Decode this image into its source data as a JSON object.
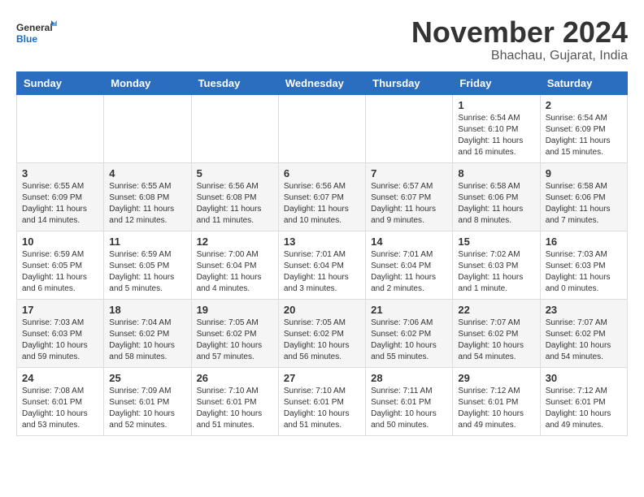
{
  "logo": {
    "general": "General",
    "blue": "Blue"
  },
  "title": "November 2024",
  "subtitle": "Bhachau, Gujarat, India",
  "days_of_week": [
    "Sunday",
    "Monday",
    "Tuesday",
    "Wednesday",
    "Thursday",
    "Friday",
    "Saturday"
  ],
  "weeks": [
    [
      {
        "day": "",
        "info": ""
      },
      {
        "day": "",
        "info": ""
      },
      {
        "day": "",
        "info": ""
      },
      {
        "day": "",
        "info": ""
      },
      {
        "day": "",
        "info": ""
      },
      {
        "day": "1",
        "info": "Sunrise: 6:54 AM\nSunset: 6:10 PM\nDaylight: 11 hours and 16 minutes."
      },
      {
        "day": "2",
        "info": "Sunrise: 6:54 AM\nSunset: 6:09 PM\nDaylight: 11 hours and 15 minutes."
      }
    ],
    [
      {
        "day": "3",
        "info": "Sunrise: 6:55 AM\nSunset: 6:09 PM\nDaylight: 11 hours and 14 minutes."
      },
      {
        "day": "4",
        "info": "Sunrise: 6:55 AM\nSunset: 6:08 PM\nDaylight: 11 hours and 12 minutes."
      },
      {
        "day": "5",
        "info": "Sunrise: 6:56 AM\nSunset: 6:08 PM\nDaylight: 11 hours and 11 minutes."
      },
      {
        "day": "6",
        "info": "Sunrise: 6:56 AM\nSunset: 6:07 PM\nDaylight: 11 hours and 10 minutes."
      },
      {
        "day": "7",
        "info": "Sunrise: 6:57 AM\nSunset: 6:07 PM\nDaylight: 11 hours and 9 minutes."
      },
      {
        "day": "8",
        "info": "Sunrise: 6:58 AM\nSunset: 6:06 PM\nDaylight: 11 hours and 8 minutes."
      },
      {
        "day": "9",
        "info": "Sunrise: 6:58 AM\nSunset: 6:06 PM\nDaylight: 11 hours and 7 minutes."
      }
    ],
    [
      {
        "day": "10",
        "info": "Sunrise: 6:59 AM\nSunset: 6:05 PM\nDaylight: 11 hours and 6 minutes."
      },
      {
        "day": "11",
        "info": "Sunrise: 6:59 AM\nSunset: 6:05 PM\nDaylight: 11 hours and 5 minutes."
      },
      {
        "day": "12",
        "info": "Sunrise: 7:00 AM\nSunset: 6:04 PM\nDaylight: 11 hours and 4 minutes."
      },
      {
        "day": "13",
        "info": "Sunrise: 7:01 AM\nSunset: 6:04 PM\nDaylight: 11 hours and 3 minutes."
      },
      {
        "day": "14",
        "info": "Sunrise: 7:01 AM\nSunset: 6:04 PM\nDaylight: 11 hours and 2 minutes."
      },
      {
        "day": "15",
        "info": "Sunrise: 7:02 AM\nSunset: 6:03 PM\nDaylight: 11 hours and 1 minute."
      },
      {
        "day": "16",
        "info": "Sunrise: 7:03 AM\nSunset: 6:03 PM\nDaylight: 11 hours and 0 minutes."
      }
    ],
    [
      {
        "day": "17",
        "info": "Sunrise: 7:03 AM\nSunset: 6:03 PM\nDaylight: 10 hours and 59 minutes."
      },
      {
        "day": "18",
        "info": "Sunrise: 7:04 AM\nSunset: 6:02 PM\nDaylight: 10 hours and 58 minutes."
      },
      {
        "day": "19",
        "info": "Sunrise: 7:05 AM\nSunset: 6:02 PM\nDaylight: 10 hours and 57 minutes."
      },
      {
        "day": "20",
        "info": "Sunrise: 7:05 AM\nSunset: 6:02 PM\nDaylight: 10 hours and 56 minutes."
      },
      {
        "day": "21",
        "info": "Sunrise: 7:06 AM\nSunset: 6:02 PM\nDaylight: 10 hours and 55 minutes."
      },
      {
        "day": "22",
        "info": "Sunrise: 7:07 AM\nSunset: 6:02 PM\nDaylight: 10 hours and 54 minutes."
      },
      {
        "day": "23",
        "info": "Sunrise: 7:07 AM\nSunset: 6:02 PM\nDaylight: 10 hours and 54 minutes."
      }
    ],
    [
      {
        "day": "24",
        "info": "Sunrise: 7:08 AM\nSunset: 6:01 PM\nDaylight: 10 hours and 53 minutes."
      },
      {
        "day": "25",
        "info": "Sunrise: 7:09 AM\nSunset: 6:01 PM\nDaylight: 10 hours and 52 minutes."
      },
      {
        "day": "26",
        "info": "Sunrise: 7:10 AM\nSunset: 6:01 PM\nDaylight: 10 hours and 51 minutes."
      },
      {
        "day": "27",
        "info": "Sunrise: 7:10 AM\nSunset: 6:01 PM\nDaylight: 10 hours and 51 minutes."
      },
      {
        "day": "28",
        "info": "Sunrise: 7:11 AM\nSunset: 6:01 PM\nDaylight: 10 hours and 50 minutes."
      },
      {
        "day": "29",
        "info": "Sunrise: 7:12 AM\nSunset: 6:01 PM\nDaylight: 10 hours and 49 minutes."
      },
      {
        "day": "30",
        "info": "Sunrise: 7:12 AM\nSunset: 6:01 PM\nDaylight: 10 hours and 49 minutes."
      }
    ]
  ]
}
